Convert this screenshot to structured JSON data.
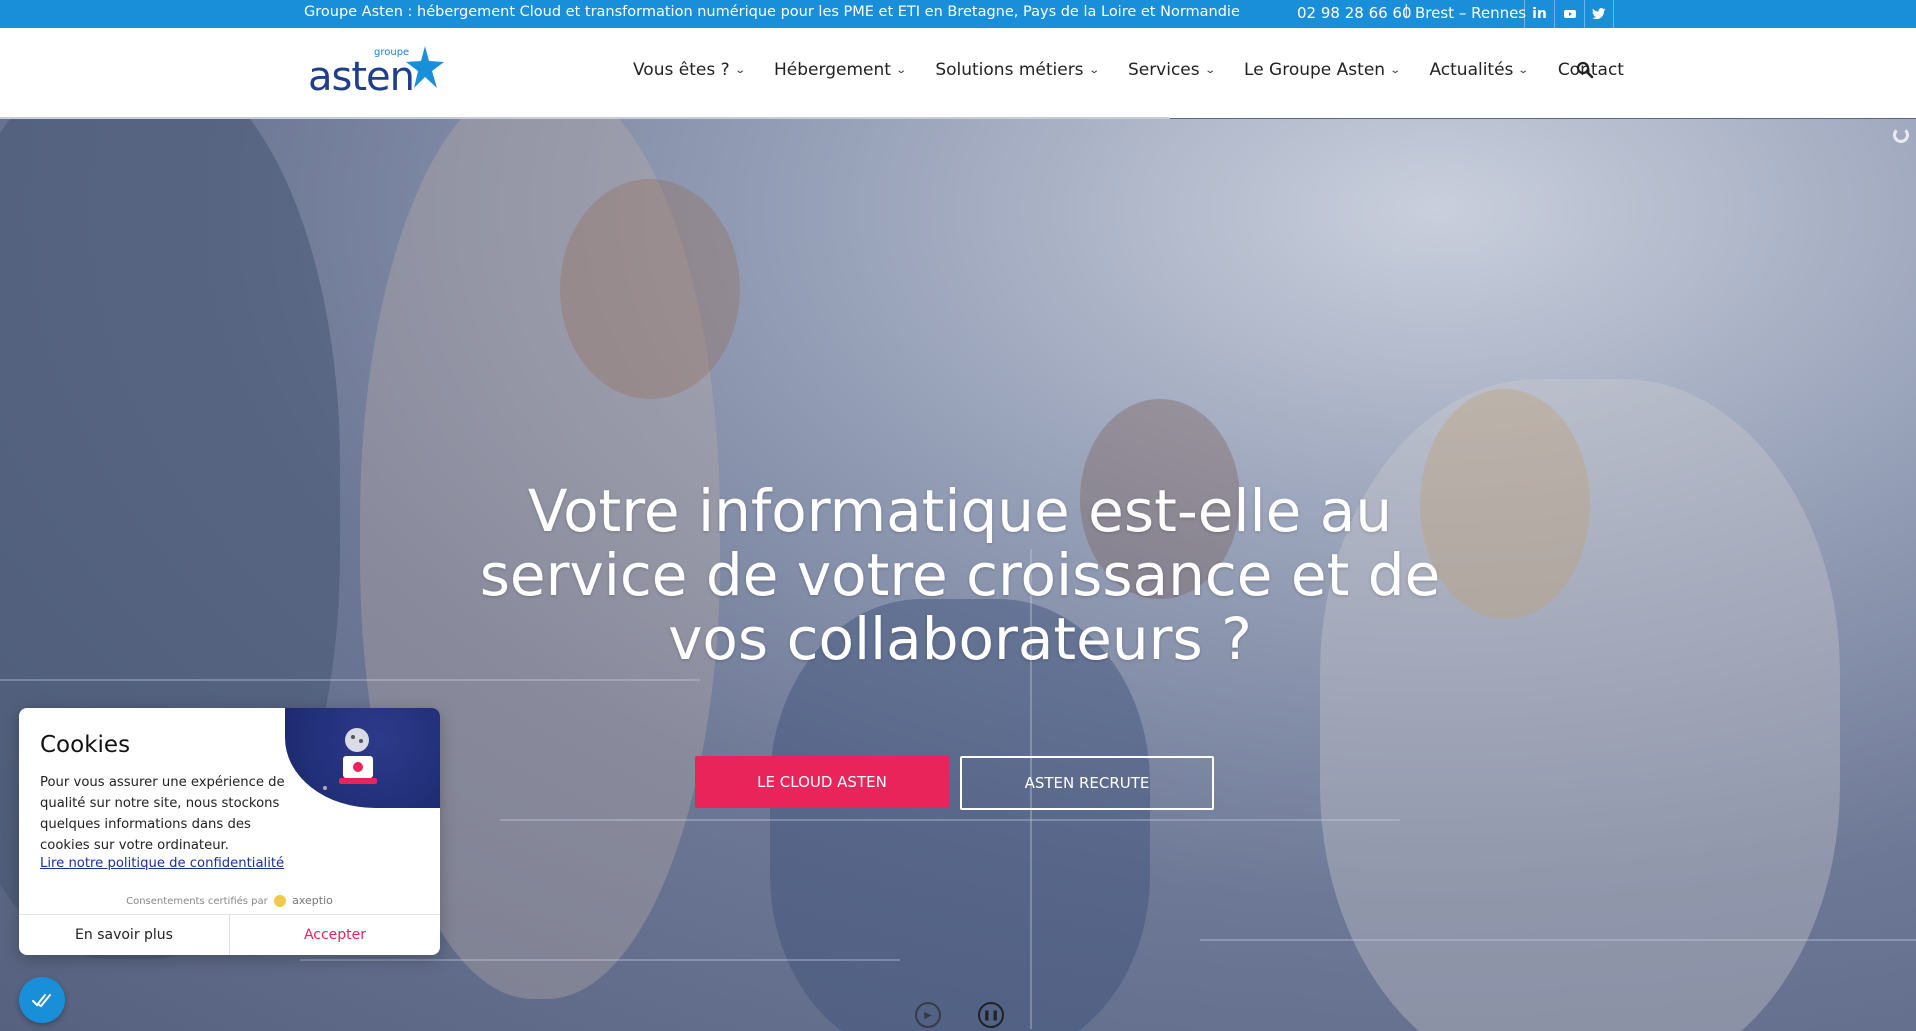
{
  "topbar": {
    "tagline": "Groupe Asten : hébergement Cloud et transformation numérique pour les PME et ETI en Bretagne, Pays de la Loire et Normandie",
    "phone": "02 98 28 66 60",
    "separator": "|",
    "cities": "Brest – Rennes",
    "social": [
      {
        "name": "linkedin",
        "glyph": "in"
      },
      {
        "name": "youtube",
        "glyph": "▶"
      },
      {
        "name": "twitter",
        "glyph": "🐦"
      }
    ]
  },
  "logo": {
    "small": "groupe",
    "word": "asten"
  },
  "nav": {
    "items": [
      {
        "label": "Vous êtes ?",
        "dropdown": true
      },
      {
        "label": "Hébergement",
        "dropdown": true
      },
      {
        "label": "Solutions métiers",
        "dropdown": true
      },
      {
        "label": "Services",
        "dropdown": true
      },
      {
        "label": "Le Groupe Asten",
        "dropdown": true
      },
      {
        "label": "Actualités",
        "dropdown": true
      },
      {
        "label": "Contact",
        "dropdown": false
      }
    ],
    "chevron": "⌄",
    "search_icon": "search-icon"
  },
  "hero": {
    "title": "Votre informatique est-elle au service de votre croissance et de vos collaborateurs ?",
    "btn_cloud": "LE CLOUD ASTEN",
    "btn_recrute": "ASTEN RECRUTE",
    "play_glyph": "▶",
    "pause_glyph": "❚❚"
  },
  "cookie": {
    "title": "Cookies",
    "text": "Pour vous assurer une expérience de qualité sur notre site, nous stockons quelques informations dans des cookies sur votre ordinateur.",
    "policy_link": "Lire notre politique de confidentialité",
    "certified": "Consentements certifiés par",
    "brand": "axeptio",
    "more": "En savoir plus",
    "accept": "Accepter"
  },
  "colors": {
    "topbar": "#1a8fd9",
    "accent": "#e8245b",
    "logo": "#1f3f8a"
  }
}
